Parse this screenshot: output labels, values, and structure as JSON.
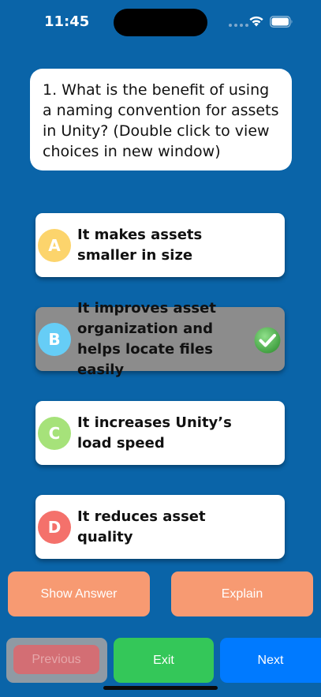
{
  "status_bar": {
    "time": "11:45"
  },
  "question": {
    "text": "1. What is the benefit of using a naming convention for assets in Unity? (Double click to view choices in new window)"
  },
  "options": [
    {
      "letter": "A",
      "text": "It makes assets smaller in size",
      "badge_color": "#fcd46c",
      "selected": false
    },
    {
      "letter": "B",
      "text": "It improves asset organization and helps locate files easily",
      "badge_color": "#66cdf6",
      "selected": true
    },
    {
      "letter": "C",
      "text": "It increases Unity’s load speed",
      "badge_color": "#a6e27a",
      "selected": false
    },
    {
      "letter": "D",
      "text": "It reduces asset quality",
      "badge_color": "#f4716b",
      "selected": false
    }
  ],
  "actions": {
    "show_answer": "Show Answer",
    "explain": "Explain",
    "previous": "Previous",
    "exit": "Exit",
    "next": "Next"
  },
  "colors": {
    "background": "#0a64a8",
    "accent_orange": "#f79a72",
    "exit_green": "#34c759",
    "next_blue": "#007aff",
    "selected_option": "#8c8c8c"
  }
}
